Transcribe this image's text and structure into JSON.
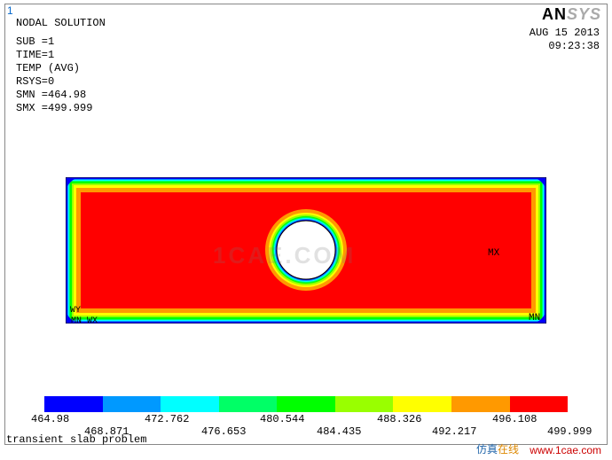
{
  "window_number": "1",
  "title": "NODAL SOLUTION",
  "header": {
    "line1": "SUB =1",
    "line2": "TIME=1",
    "line3": "TEMP     (AVG)",
    "line4": "RSYS=0",
    "line5": "SMN =464.98",
    "line6": "SMX =499.999"
  },
  "logo": {
    "part1": "AN",
    "part2": "SYS"
  },
  "date": "AUG 15 2013",
  "time": "09:23:38",
  "labels": {
    "mx": "MX",
    "mn": "MN",
    "wy": "WY",
    "wx": "MN   WX"
  },
  "caption": "transient slab problem",
  "watermark": "1CAE.COM",
  "footer_text_a": "仿真",
  "footer_text_b": "在线",
  "footer_link": "www.1cae.com",
  "legend": {
    "colors": [
      "#0000ff",
      "#0099ff",
      "#00ffff",
      "#00ff66",
      "#00ff00",
      "#99ff00",
      "#ffff00",
      "#ff9900",
      "#ff0000"
    ],
    "ticks": [
      "464.98",
      "468.871",
      "472.762",
      "476.653",
      "480.544",
      "484.435",
      "488.326",
      "492.217",
      "496.108",
      "499.999"
    ]
  },
  "chart_data": {
    "type": "heatmap",
    "title": "NODAL SOLUTION — TEMP (AVG)",
    "variable": "TEMP",
    "sub": 1,
    "time": 1,
    "rsys": 0,
    "smn": 464.98,
    "smx": 499.999,
    "colorbar": {
      "values": [
        464.98,
        468.871,
        472.762,
        476.653,
        480.544,
        484.435,
        488.326,
        492.217,
        496.108,
        499.999
      ],
      "colors": [
        "#0000ff",
        "#0099ff",
        "#00ffff",
        "#00ff66",
        "#00ff00",
        "#99ff00",
        "#ffff00",
        "#ff9900",
        "#ff0000"
      ]
    },
    "geometry": "rectangular slab with central circular hole",
    "field_description": "Temperature is ~SMX (red ~499) throughout the bulk interior; thin boundary layers at the outer rectangle edges and around the inner hole rim transition through orange→yellow→green→cyan→blue; the four outer corners and the hole inner rim reach SMN (blue ~465). MX marker in bulk interior right side; MN marker at lower-right outer corner."
  }
}
